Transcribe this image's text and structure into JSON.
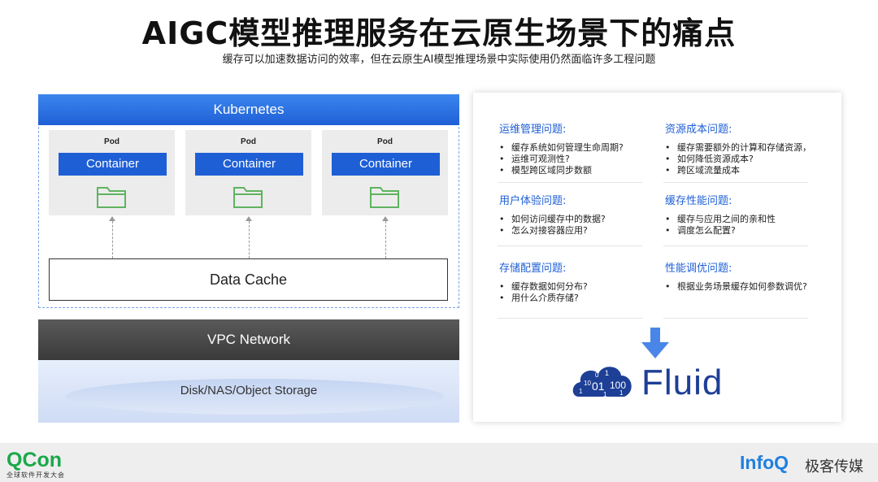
{
  "header": {
    "title": "AIGC模型推理服务在云原生场景下的痛点",
    "subtitle": "缓存可以加速数据访问的效率，但在云原生AI模型推理场景中实际使用仍然面临许多工程问题"
  },
  "diagram": {
    "kubernetes": "Kubernetes",
    "pods": [
      {
        "label": "Pod",
        "container": "Container"
      },
      {
        "label": "Pod",
        "container": "Container"
      },
      {
        "label": "Pod",
        "container": "Container"
      }
    ],
    "data_cache": "Data Cache",
    "vpc_network": "VPC Network",
    "storage": "Disk/NAS/Object Storage"
  },
  "issues": {
    "ops": {
      "title": "运维管理问题:",
      "items": [
        "缓存系统如何管理生命周期?",
        "运维可观测性?",
        "模型跨区域同步数额"
      ]
    },
    "cost": {
      "title": "资源成本问题:",
      "items": [
        "缓存需要额外的计算和存储资源，",
        "如何降低资源成本?",
        "跨区域流量成本"
      ]
    },
    "ux": {
      "title": "用户体验问题:",
      "items": [
        "如何访问缓存中的数据?",
        "怎么对接容器应用?"
      ]
    },
    "perf": {
      "title": "缓存性能问题:",
      "items": [
        "缓存与应用之间的亲和性",
        "调度怎么配置?"
      ]
    },
    "storage": {
      "title": "存储配置问题:",
      "items": [
        "缓存数据如何分布?",
        "用什么介质存储?"
      ]
    },
    "tuning": {
      "title": "性能调优问题:",
      "items": [
        "根据业务场景缓存如何参数调优?"
      ]
    }
  },
  "fluid": {
    "name": "Fluid",
    "logo_digits": [
      "10",
      "1",
      "0",
      "01",
      "100",
      "1",
      "1",
      "1"
    ]
  },
  "footer": {
    "qcon": "QCon",
    "qcon_sub": "全球软件开发大会",
    "infoq": "InfoQ",
    "geek": "极客传媒"
  },
  "colors": {
    "accent_blue": "#1f5fd6",
    "dark_gray": "#3a3a3a",
    "folder_green": "#5fb35f",
    "qcon_green": "#1aa84a",
    "fluid_navy": "#1e3f96"
  },
  "icons": [
    "folder-icon",
    "down-arrow-icon",
    "fluid-cloud-icon"
  ]
}
